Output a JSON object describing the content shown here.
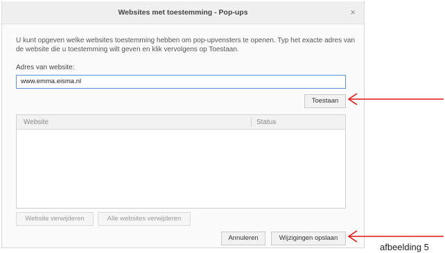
{
  "dialog": {
    "title": "Websites met toestemming - Pop-ups",
    "close_glyph": "×",
    "description": "U kunt opgeven welke websites toestemming hebben om pop-upvensters te openen. Typ het exacte adres van de website die u toestemming wilt geven en klik vervolgens op Toestaan.",
    "address_label": "Adres van website:",
    "address_value": "www.emma.eisma.nl",
    "allow_button": "Toestaan",
    "table": {
      "columns": [
        "Website",
        "Status"
      ],
      "rows": []
    },
    "remove_website_button": "Website verwijderen",
    "remove_all_button": "Alle websites verwijderen",
    "cancel_button": "Annuleren",
    "save_button": "Wijzigingen opslaan"
  },
  "annotation": {
    "caption": "afbeelding 5",
    "arrow_color": "#e01010"
  }
}
